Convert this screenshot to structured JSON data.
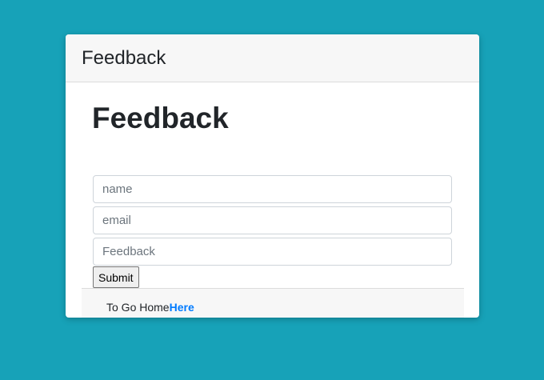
{
  "card": {
    "header_title": "Feedback"
  },
  "form": {
    "title": "Feedback",
    "name": {
      "placeholder": "name",
      "value": ""
    },
    "email": {
      "placeholder": "email",
      "value": ""
    },
    "feedback": {
      "placeholder": "Feedback",
      "value": ""
    },
    "submit_label": "Submit"
  },
  "footer": {
    "text": "To Go Home",
    "link_label": "Here"
  },
  "colors": {
    "background": "#17a2b8",
    "link": "#007bff"
  }
}
